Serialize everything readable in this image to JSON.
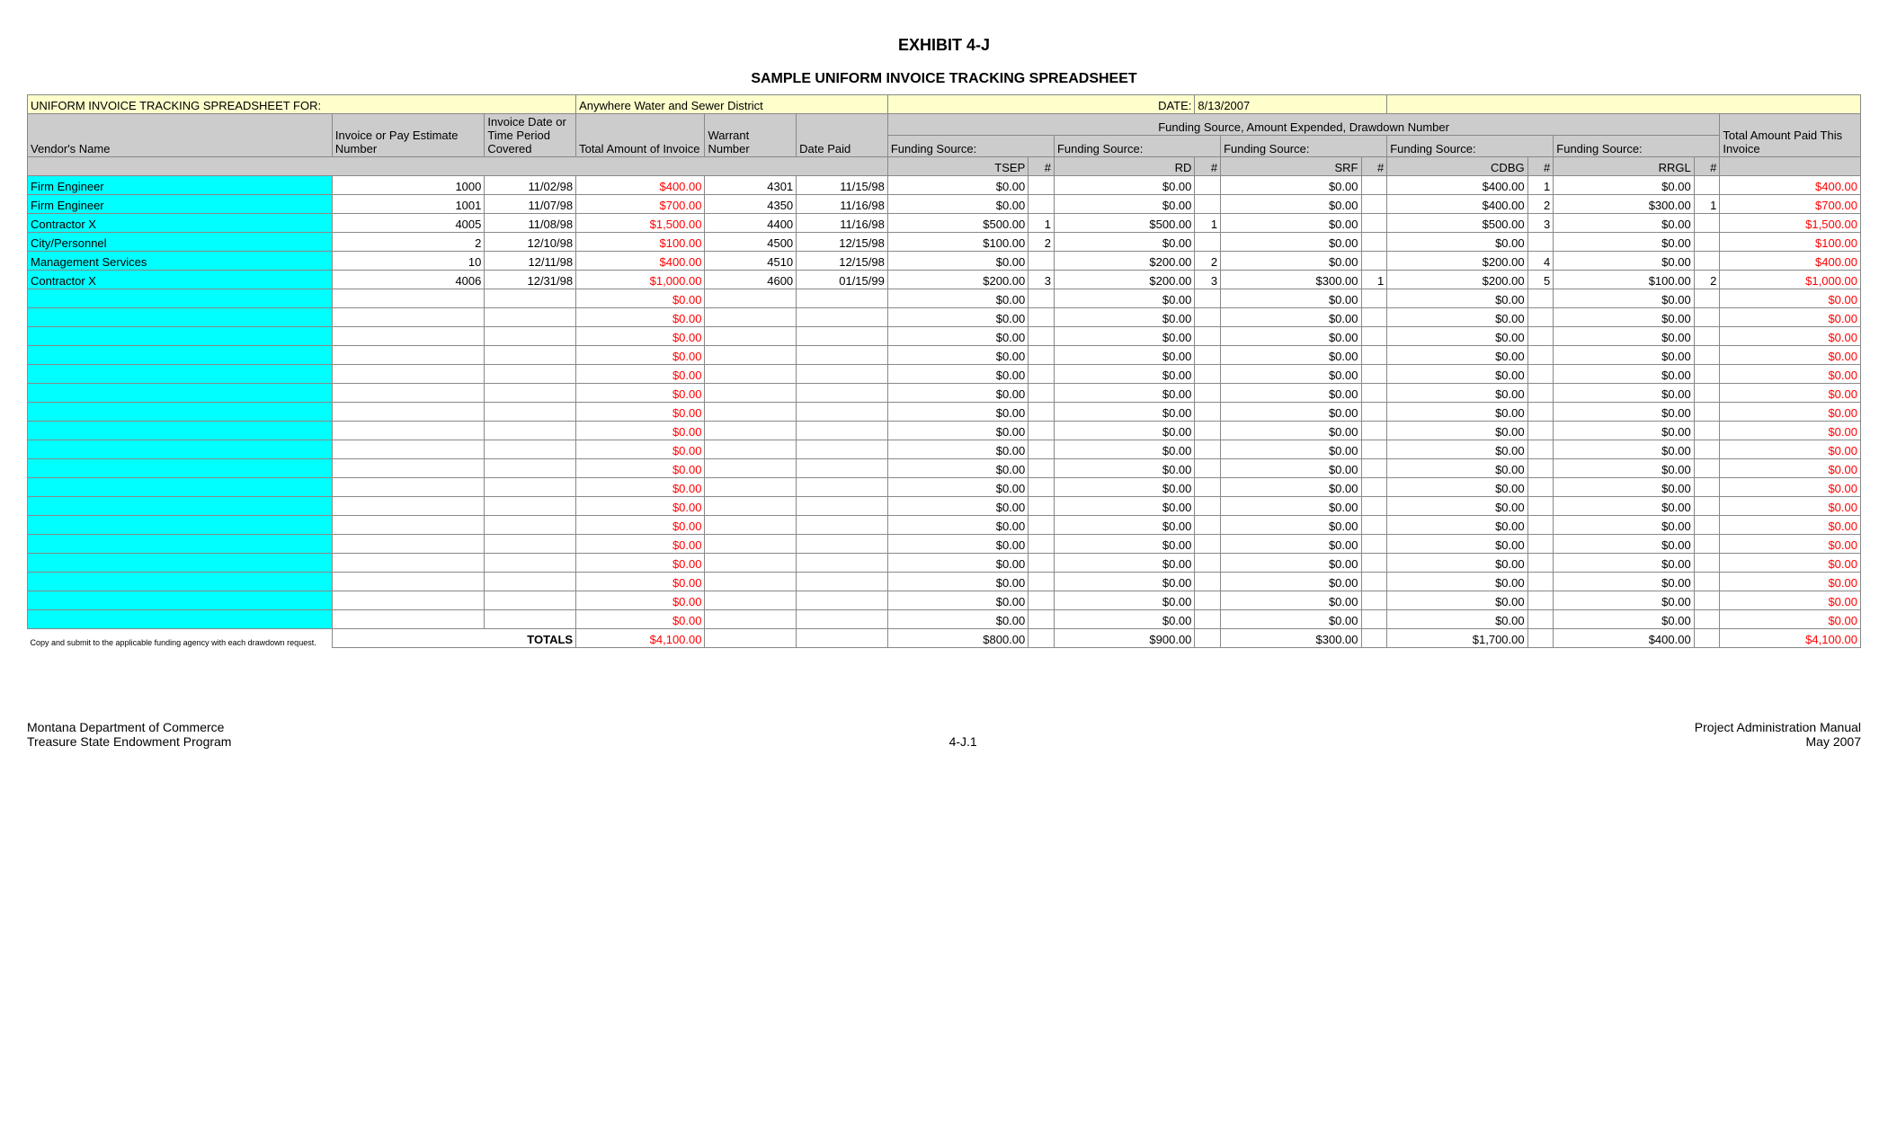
{
  "titles": {
    "exhibit": "EXHIBIT 4-J",
    "subtitle": "SAMPLE UNIFORM INVOICE TRACKING SPREADSHEET",
    "for_label": "UNIFORM INVOICE TRACKING SPREADSHEET FOR:",
    "for_value": "Anywhere Water and Sewer District",
    "date_label": "DATE:",
    "date_value": "8/13/2007",
    "funding_header": "Funding Source, Amount Expended, Drawdown Number",
    "funding_source_label": "Funding Source:",
    "hash": "#",
    "totals_label": "TOTALS",
    "footnote": "Copy and submit to the applicable funding agency with each drawdown request."
  },
  "columns": {
    "vendor": "Vendor's Name",
    "invoice_no": "Invoice or Pay Estimate Number",
    "inv_date": "Invoice Date or Time Period Covered",
    "total_amt": "Total Amount of Invoice",
    "warrant": "Warrant Number",
    "date_paid": "Date Paid",
    "total_paid": "Total Amount Paid This Invoice",
    "sources": [
      "TSEP",
      "RD",
      "SRF",
      "CDBG",
      "RRGL"
    ]
  },
  "rows": [
    {
      "vendor": "Firm Engineer",
      "inv": "1000",
      "date": "11/02/98",
      "total": "$400.00",
      "warr": "4301",
      "paid": "11/15/98",
      "fs": [
        "$0.00",
        "",
        "$0.00",
        "",
        "$0.00",
        "",
        "$400.00",
        "1",
        "$0.00",
        ""
      ],
      "tp": "$400.00"
    },
    {
      "vendor": "Firm Engineer",
      "inv": "1001",
      "date": "11/07/98",
      "total": "$700.00",
      "warr": "4350",
      "paid": "11/16/98",
      "fs": [
        "$0.00",
        "",
        "$0.00",
        "",
        "$0.00",
        "",
        "$400.00",
        "2",
        "$300.00",
        "1"
      ],
      "tp": "$700.00"
    },
    {
      "vendor": "Contractor X",
      "inv": "4005",
      "date": "11/08/98",
      "total": "$1,500.00",
      "warr": "4400",
      "paid": "11/16/98",
      "fs": [
        "$500.00",
        "1",
        "$500.00",
        "1",
        "$0.00",
        "",
        "$500.00",
        "3",
        "$0.00",
        ""
      ],
      "tp": "$1,500.00"
    },
    {
      "vendor": "City/Personnel",
      "inv": "2",
      "date": "12/10/98",
      "total": "$100.00",
      "warr": "4500",
      "paid": "12/15/98",
      "fs": [
        "$100.00",
        "2",
        "$0.00",
        "",
        "$0.00",
        "",
        "$0.00",
        "",
        "$0.00",
        ""
      ],
      "tp": "$100.00"
    },
    {
      "vendor": "Management Services",
      "inv": "10",
      "date": "12/11/98",
      "total": "$400.00",
      "warr": "4510",
      "paid": "12/15/98",
      "fs": [
        "$0.00",
        "",
        "$200.00",
        "2",
        "$0.00",
        "",
        "$200.00",
        "4",
        "$0.00",
        ""
      ],
      "tp": "$400.00"
    },
    {
      "vendor": "Contractor X",
      "inv": "4006",
      "date": "12/31/98",
      "total": "$1,000.00",
      "warr": "4600",
      "paid": "01/15/99",
      "fs": [
        "$200.00",
        "3",
        "$200.00",
        "3",
        "$300.00",
        "1",
        "$200.00",
        "5",
        "$100.00",
        "2"
      ],
      "tp": "$1,000.00"
    }
  ],
  "empty": {
    "total": "$0.00",
    "fs": [
      "$0.00",
      "",
      "$0.00",
      "",
      "$0.00",
      "",
      "$0.00",
      "",
      "$0.00",
      ""
    ],
    "tp": "$0.00"
  },
  "empty_count": 18,
  "totals": {
    "total": "$4,100.00",
    "fs": [
      "$800.00",
      "",
      "$900.00",
      "",
      "$300.00",
      "",
      "$1,700.00",
      "",
      "$400.00",
      ""
    ],
    "tp": "$4,100.00"
  },
  "footer": {
    "left1": "Montana Department of Commerce",
    "left2": "Treasure State Endowment Program",
    "mid": "4-J.1",
    "right1": "Project Administration Manual",
    "right2": "May 2007"
  },
  "chart_data": {
    "type": "table",
    "title": "Sample Uniform Invoice Tracking Spreadsheet",
    "columns": [
      "Vendor's Name",
      "Invoice or Pay Estimate Number",
      "Invoice Date",
      "Total Amount of Invoice",
      "Warrant Number",
      "Date Paid",
      "TSEP",
      "#",
      "RD",
      "#",
      "SRF",
      "#",
      "CDBG",
      "#",
      "RRGL",
      "#",
      "Total Amount Paid This Invoice"
    ],
    "rows": [
      [
        "Firm Engineer",
        1000,
        "11/02/98",
        400.0,
        4301,
        "11/15/98",
        0.0,
        null,
        0.0,
        null,
        0.0,
        null,
        400.0,
        1,
        0.0,
        null,
        400.0
      ],
      [
        "Firm Engineer",
        1001,
        "11/07/98",
        700.0,
        4350,
        "11/16/98",
        0.0,
        null,
        0.0,
        null,
        0.0,
        null,
        400.0,
        2,
        300.0,
        1,
        700.0
      ],
      [
        "Contractor X",
        4005,
        "11/08/98",
        1500.0,
        4400,
        "11/16/98",
        500.0,
        1,
        500.0,
        1,
        0.0,
        null,
        500.0,
        3,
        0.0,
        null,
        1500.0
      ],
      [
        "City/Personnel",
        2,
        "12/10/98",
        100.0,
        4500,
        "12/15/98",
        100.0,
        2,
        0.0,
        null,
        0.0,
        null,
        0.0,
        null,
        0.0,
        null,
        100.0
      ],
      [
        "Management Services",
        10,
        "12/11/98",
        400.0,
        4510,
        "12/15/98",
        0.0,
        null,
        200.0,
        2,
        0.0,
        null,
        200.0,
        4,
        0.0,
        null,
        400.0
      ],
      [
        "Contractor X",
        4006,
        "12/31/98",
        1000.0,
        4600,
        "01/15/99",
        200.0,
        3,
        200.0,
        3,
        300.0,
        1,
        200.0,
        5,
        100.0,
        2,
        1000.0
      ]
    ],
    "totals": [
      "TOTALS",
      null,
      null,
      4100.0,
      null,
      null,
      800.0,
      null,
      900.0,
      null,
      300.0,
      null,
      1700.0,
      null,
      400.0,
      null,
      4100.0
    ]
  }
}
